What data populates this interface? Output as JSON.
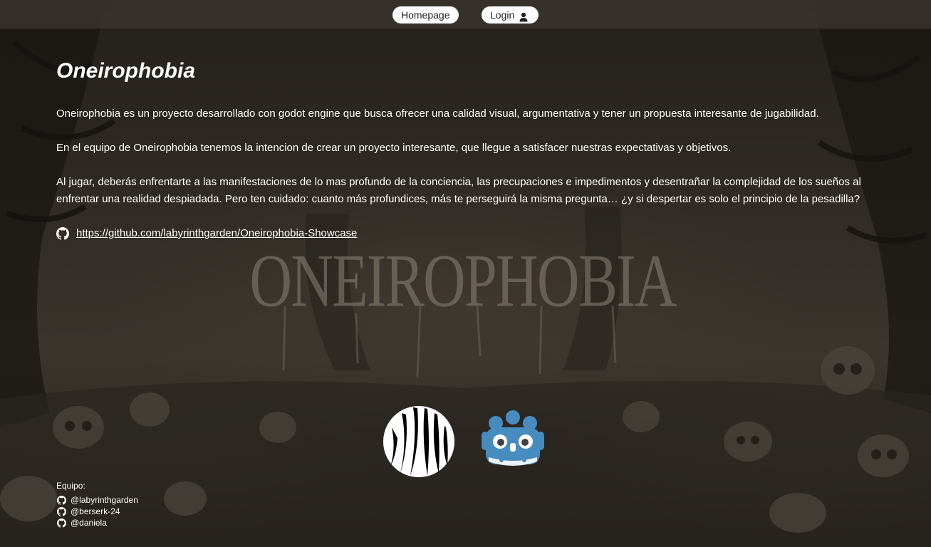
{
  "nav": {
    "home_label": "Homepage",
    "login_label": "Login",
    "login_icon": "user-icon"
  },
  "project": {
    "title": "Oneirophobia",
    "paragraphs": [
      "Oneirophobia es un proyecto desarrollado con godot engine que busca ofrecer una calidad visual, argumentativa y tener un propuesta interesante de jugabilidad.",
      "En el equipo de Oneirophobia tenemos la intencion de crear un proyecto interesante, que llegue a satisfacer nuestras expectativas y objetivos.",
      "Al jugar, deberás enfrentarte a las manifestaciones de lo mas profundo de la conciencia, las precupaciones e impedimentos y desentrañar la complejidad de los sueños al enfrentar una realidad despiadada. Pero ten cuidado: cuanto más profundices, más te perseguirá la misma pregunta… ¿y si despertar es solo el principio de la pesadilla?"
    ],
    "repo_icon": "github-icon",
    "repo_url": "https://github.com/labyrinthgarden/Oneirophobia-Showcase",
    "watermark_text": "ONEIROPHOBIA"
  },
  "logos": {
    "game_logo": "oneirophobia-logo",
    "engine_logo": "godot-logo"
  },
  "footer": {
    "team_label": "Equipo:",
    "members": [
      "@labyrinthgarden",
      "@berserk-24",
      "@daniela"
    ]
  },
  "colors": {
    "nav_button_bg": "#ffffff",
    "godot_blue": "#478cbf",
    "text": "#ffffff"
  }
}
